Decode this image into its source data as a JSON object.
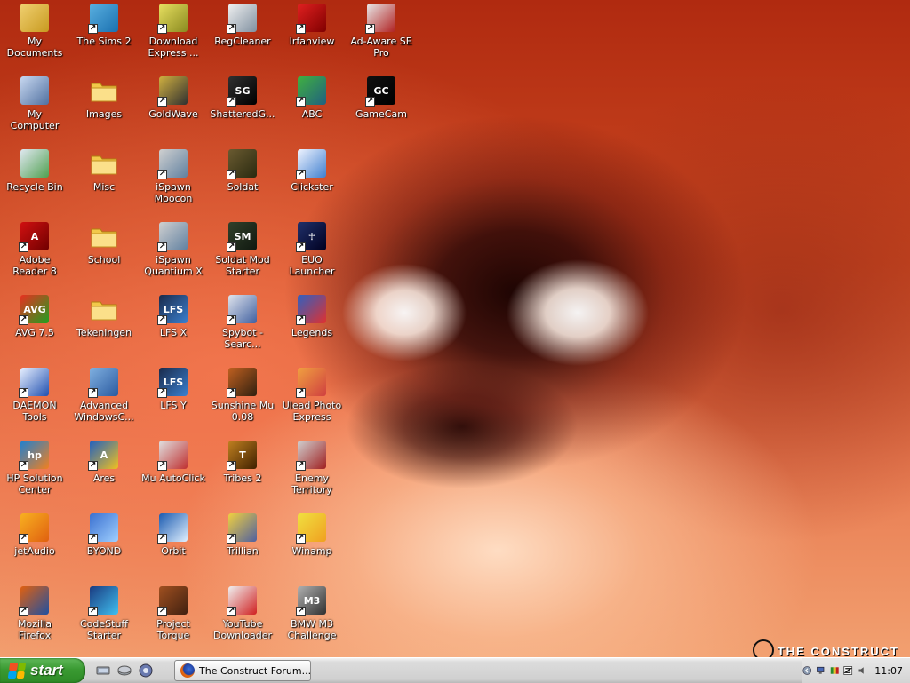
{
  "desktop": {
    "icons": [
      {
        "label": "My Documents",
        "icon": "my-documents-icon",
        "shortcut": false
      },
      {
        "label": "The Sims 2",
        "icon": "sims-icon",
        "shortcut": true
      },
      {
        "label": "Download Express ...",
        "icon": "download-express-icon",
        "shortcut": true
      },
      {
        "label": "RegCleaner",
        "icon": "regcleaner-icon",
        "shortcut": true
      },
      {
        "label": "Irfanview",
        "icon": "irfanview-icon",
        "shortcut": true
      },
      {
        "label": "Ad-Aware SE Pro",
        "icon": "ad-aware-icon",
        "shortcut": true
      },
      {
        "label": "My Computer",
        "icon": "my-computer-icon",
        "shortcut": false
      },
      {
        "label": "Images",
        "icon": "folder-icon",
        "shortcut": false
      },
      {
        "label": "GoldWave",
        "icon": "goldwave-icon",
        "shortcut": true
      },
      {
        "label": "ShatteredG...",
        "icon": "shattered-icon",
        "shortcut": true
      },
      {
        "label": "ABC",
        "icon": "abc-icon",
        "shortcut": true
      },
      {
        "label": "GameCam",
        "icon": "gamecam-icon",
        "shortcut": true
      },
      {
        "label": "Recycle Bin",
        "icon": "recycle-bin-icon",
        "shortcut": false
      },
      {
        "label": "Misc",
        "icon": "folder-icon",
        "shortcut": false
      },
      {
        "label": "iSpawn Moocon",
        "icon": "ispawn-icon",
        "shortcut": true
      },
      {
        "label": "Soldat",
        "icon": "soldat-icon",
        "shortcut": true
      },
      {
        "label": "Clickster",
        "icon": "clickster-icon",
        "shortcut": true
      },
      {
        "label": "Adobe Reader 8",
        "icon": "adobe-reader-icon",
        "shortcut": true
      },
      {
        "label": "School",
        "icon": "folder-icon",
        "shortcut": false
      },
      {
        "label": "iSpawn Quantium X",
        "icon": "ispawn-icon",
        "shortcut": true
      },
      {
        "label": "Soldat Mod Starter",
        "icon": "soldat-mod-icon",
        "shortcut": true
      },
      {
        "label": "EUO Launcher",
        "icon": "euo-launcher-icon",
        "shortcut": true
      },
      {
        "label": "AVG 7.5",
        "icon": "avg-icon",
        "shortcut": true
      },
      {
        "label": "Tekeningen",
        "icon": "folder-icon",
        "shortcut": false
      },
      {
        "label": "LFS X",
        "icon": "lfs-icon",
        "shortcut": true
      },
      {
        "label": "Spybot - Searc...",
        "icon": "spybot-icon",
        "shortcut": true
      },
      {
        "label": "Legends",
        "icon": "legends-icon",
        "shortcut": true
      },
      {
        "label": "DAEMON Tools",
        "icon": "daemon-tools-icon",
        "shortcut": true
      },
      {
        "label": "Advanced WindowsC...",
        "icon": "advanced-windows-icon",
        "shortcut": true
      },
      {
        "label": "LFS Y",
        "icon": "lfs-icon",
        "shortcut": true
      },
      {
        "label": "Sunshine Mu 0.08",
        "icon": "sunshine-mu-icon",
        "shortcut": true
      },
      {
        "label": "Ulead Photo Express",
        "icon": "ulead-icon",
        "shortcut": true
      },
      {
        "label": "HP Solution Center",
        "icon": "hp-icon",
        "shortcut": true
      },
      {
        "label": "Ares",
        "icon": "ares-icon",
        "shortcut": true
      },
      {
        "label": "Mu AutoClick",
        "icon": "mu-autoclick-icon",
        "shortcut": true
      },
      {
        "label": "Tribes 2",
        "icon": "tribes-icon",
        "shortcut": true
      },
      {
        "label": "Enemy Territory",
        "icon": "enemy-territory-icon",
        "shortcut": true
      },
      {
        "label": "jetAudio",
        "icon": "jetaudio-icon",
        "shortcut": true
      },
      {
        "label": "BYOND",
        "icon": "byond-icon",
        "shortcut": true
      },
      {
        "label": "Orbit",
        "icon": "orbit-icon",
        "shortcut": true
      },
      {
        "label": "Trillian",
        "icon": "trillian-icon",
        "shortcut": true
      },
      {
        "label": "Winamp",
        "icon": "winamp-icon",
        "shortcut": true
      },
      {
        "label": "Mozilla Firefox",
        "icon": "firefox-icon",
        "shortcut": true
      },
      {
        "label": "CodeStuff Starter",
        "icon": "codestuff-icon",
        "shortcut": true
      },
      {
        "label": "Project Torque",
        "icon": "project-torque-icon",
        "shortcut": true
      },
      {
        "label": "YouTube Downloader",
        "icon": "youtube-downloader-icon",
        "shortcut": true
      },
      {
        "label": "BMW M3 Challenge",
        "icon": "bmw-icon",
        "shortcut": true
      }
    ],
    "watermark": "THE CONSTRUCT"
  },
  "taskbar": {
    "start_label": "start",
    "quick_launch": [
      "show-desktop-icon",
      "media-icon",
      "browser-quicklaunch-icon"
    ],
    "tasks": [
      {
        "label": "The Construct Forum...",
        "icon": "firefox-icon"
      }
    ],
    "tray_icons": [
      "tray-expand-icon",
      "network-icon",
      "colors-icon",
      "zonealarm-icon",
      "speaker-icon"
    ],
    "clock": "11:07"
  },
  "colors": {
    "start_green": "#3a9a32",
    "taskbar_gray": "#d4d4d4",
    "wallpaper_red": "#c0402a"
  }
}
